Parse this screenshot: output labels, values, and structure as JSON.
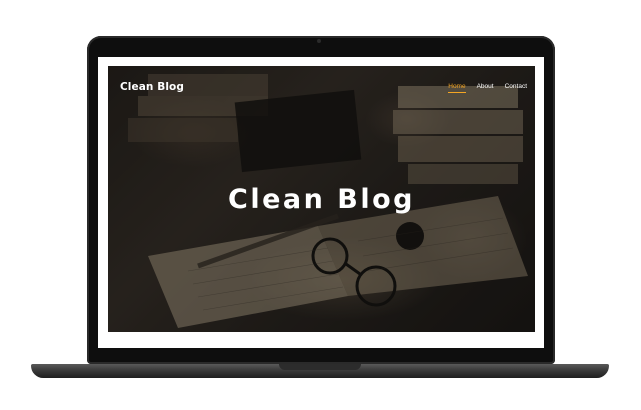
{
  "site": {
    "brand": "Clean Blog",
    "hero_title": "Clean Blog"
  },
  "nav": {
    "items": [
      {
        "label": "Home",
        "active": true
      },
      {
        "label": "About",
        "active": false
      },
      {
        "label": "Contact",
        "active": false
      }
    ]
  },
  "colors": {
    "accent": "#f5a623",
    "text": "#ffffff",
    "bezel": "#0e0e0e"
  }
}
